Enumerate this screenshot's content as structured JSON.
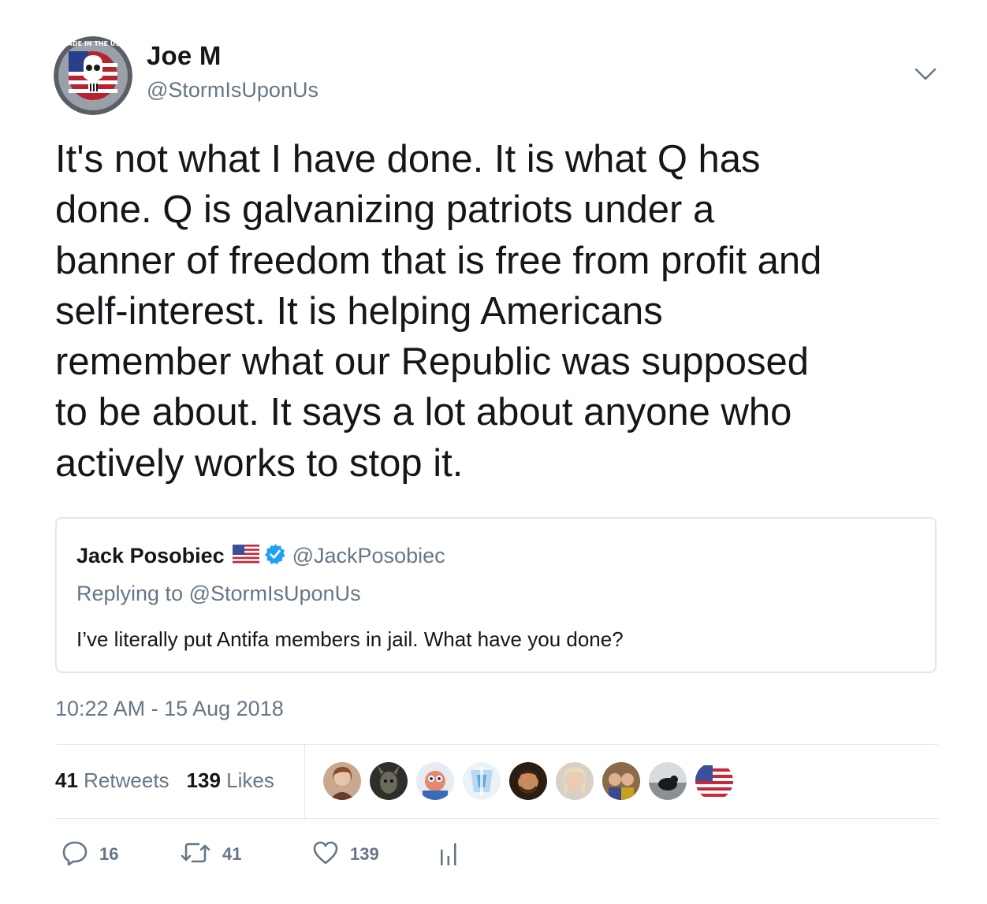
{
  "author": {
    "display_name": "Joe M",
    "handle": "@StormIsUponUs",
    "avatar_icon": "usa-punisher-badge-icon",
    "avatar_ring_text": "MADE IN THE USA"
  },
  "tweet": {
    "text": "It's not what I have done. It is what Q has\ndone. Q is galvanizing patriots under a\nbanner of freedom that is free from profit and\nself-interest. It is helping Americans\nremember what our Republic was supposed\nto be about. It says a lot about anyone who\nactively works to stop it.",
    "timestamp": "10:22 AM - 15 Aug 2018"
  },
  "quoted_tweet": {
    "display_name": "Jack Posobiec",
    "flag_icon": "us-flag-icon",
    "verified_icon": "verified-badge-icon",
    "handle": "@JackPosobiec",
    "replying_prefix": "Replying to",
    "replying_to": "@StormIsUponUs",
    "text": "I’ve literally put Antifa members in jail. What have you done?"
  },
  "stats": {
    "retweets_count": "41",
    "retweets_label": "Retweets",
    "likes_count": "139",
    "likes_label": "Likes"
  },
  "actions": {
    "reply_count": "16",
    "retweet_count": "41",
    "like_count": "139"
  },
  "colors": {
    "text": "#14171a",
    "secondary": "#657786",
    "border": "#e1e8ed",
    "verified": "#1da1f2"
  }
}
